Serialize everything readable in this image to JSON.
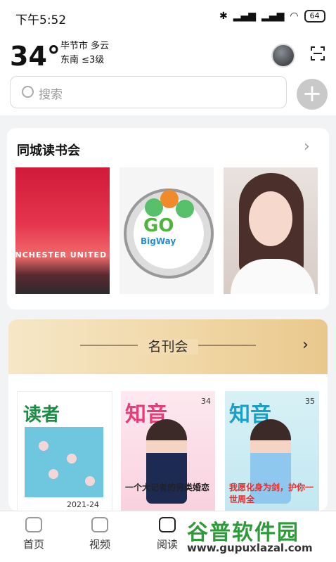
{
  "status_bar": {
    "time": "下午5:52",
    "battery": "64"
  },
  "weather": {
    "temperature": "34°",
    "location": "毕节市 多云",
    "wind": "东南 ≤3级"
  },
  "search": {
    "placeholder": "搜索"
  },
  "book_club": {
    "title": "同城读书会",
    "covers": [
      {
        "text": "ANCHESTER UNITED"
      },
      {
        "text": "GO",
        "sub": "BigWay"
      },
      {
        "text": ""
      }
    ]
  },
  "magazine_section": {
    "title": "名刊会",
    "magazines": [
      {
        "name": "读者",
        "issue": "2021-24"
      },
      {
        "name": "知音",
        "issue": "34",
        "headline": "一个大记者的另类婚恋"
      },
      {
        "name": "知音",
        "issue": "35",
        "headline": "我愿化身为剑，护你一世周全"
      }
    ]
  },
  "tabs": [
    {
      "label": "首页"
    },
    {
      "label": "视频"
    },
    {
      "label": "阅读"
    }
  ],
  "watermark": {
    "line1": "谷普软件园",
    "line2": "www.gupuxlazal.com"
  }
}
